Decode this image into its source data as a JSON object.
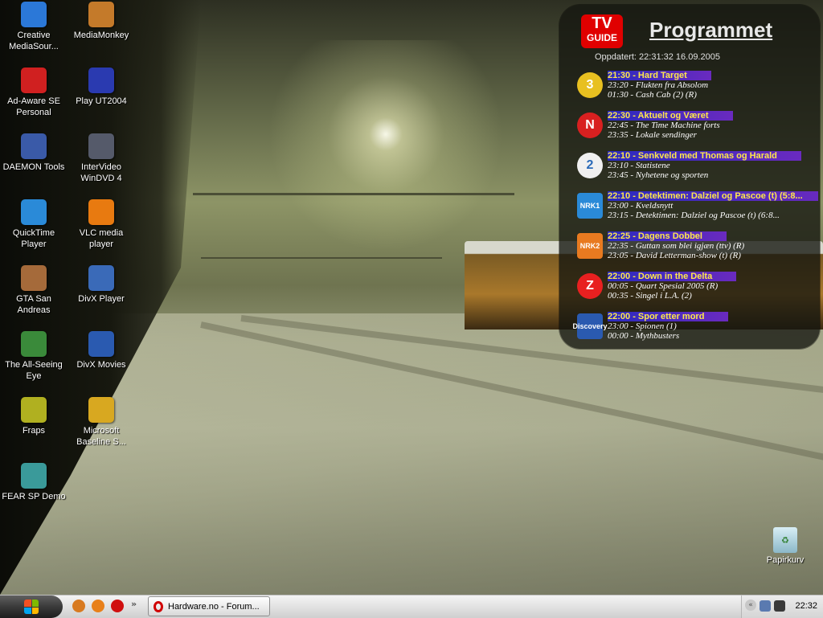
{
  "desktop": {
    "icons": [
      {
        "label": "Creative MediaSour...",
        "icon": "creative-mediasource-icon",
        "color": "#2b78d8"
      },
      {
        "label": "MediaMonkey",
        "icon": "mediamonkey-icon",
        "color": "#c47a2a"
      },
      {
        "label": "Ad-Aware SE Personal",
        "icon": "ad-aware-icon",
        "color": "#d02020"
      },
      {
        "label": "Play UT2004",
        "icon": "ut2004-icon",
        "color": "#2a3ab0"
      },
      {
        "label": "DAEMON Tools",
        "icon": "daemon-tools-icon",
        "color": "#3a5aa8"
      },
      {
        "label": "InterVideo WinDVD 4",
        "icon": "windvd-icon",
        "color": "#555a6a"
      },
      {
        "label": "QuickTime Player",
        "icon": "quicktime-icon",
        "color": "#2a8ad8"
      },
      {
        "label": "VLC media player",
        "icon": "vlc-icon",
        "color": "#e87a10"
      },
      {
        "label": "GTA San Andreas",
        "icon": "gta-san-andreas-icon",
        "color": "#a56a3a"
      },
      {
        "label": "DivX Player",
        "icon": "divx-player-icon",
        "color": "#3a6ab8"
      },
      {
        "label": "The All-Seeing Eye",
        "icon": "all-seeing-eye-icon",
        "color": "#3a8a3a"
      },
      {
        "label": "DivX Movies",
        "icon": "divx-movies-icon",
        "color": "#2a5ab0"
      },
      {
        "label": "Fraps",
        "icon": "fraps-icon",
        "color": "#b0b020"
      },
      {
        "label": "Microsoft Baseline S...",
        "icon": "mbsa-icon",
        "color": "#d8a820"
      },
      {
        "label": "FEAR SP Demo",
        "icon": "fear-icon",
        "color": "#3a9a9a"
      }
    ],
    "recycle_bin": {
      "label": "Papirkurv",
      "icon": "recycle-bin-icon"
    }
  },
  "tvguide": {
    "logo_line1": "TV",
    "logo_line2": "GUIDE",
    "title": "Programmet",
    "updated": "Oppdatert: 22:31:32 16.09.2005",
    "channels": [
      {
        "logo": "3",
        "logo_color": "#e8c020",
        "icon": "tv3-logo-icon",
        "now": "21:30 - Hard Target",
        "next1": "23:20 - Flukten fra Absolom",
        "next2": "01:30 - Cash Cab (2) (R)"
      },
      {
        "logo": "N",
        "logo_color": "#d82020",
        "icon": "tvnorge-logo-icon",
        "now": "22:30 - Aktuelt og Været",
        "next1": "22:45 - The Time Machine forts",
        "next2": "23:35 - Lokale sendinger"
      },
      {
        "logo": "2",
        "logo_color": "#f0f0f0",
        "icon": "tv2-logo-icon",
        "now": "22:10 - Senkveld med Thomas og Harald",
        "next1": "23:10 - Statistene",
        "next2": "23:45 - Nyhetene og sporten"
      },
      {
        "logo": "NRK1",
        "logo_color": "#2a8ad8",
        "icon": "nrk1-logo-icon",
        "now": "22:10 - Detektimen: Dalziel og Pascoe (t) (5:8...",
        "next1": "23:00 - Kveldsnytt",
        "next2": "23:15 - Detektimen: Dalziel og Pascoe (t) (6:8..."
      },
      {
        "logo": "NRK2",
        "logo_color": "#e87a20",
        "icon": "nrk2-logo-icon",
        "now": "22:25 - Dagens Dobbel",
        "next1": "22:35 - Guttan som blei igjæn (ttv) (R)",
        "next2": "23:05 - David Letterman-show (t) (R)"
      },
      {
        "logo": "Z",
        "logo_color": "#e82020",
        "icon": "zebra-logo-icon",
        "now": "22:00 - Down in the Delta",
        "next1": "00:05 - Quart Spesial 2005 (R)",
        "next2": "00:35 - Singel i L.A. (2)"
      },
      {
        "logo": "Discovery",
        "logo_color": "#2a5ab0",
        "icon": "discovery-logo-icon",
        "now": "22:00 - Spor etter mord",
        "next1": "23:00 - Spionen (1)",
        "next2": "00:00 - Mythbusters"
      }
    ]
  },
  "taskbar": {
    "start_icon": "windows-start-icon",
    "quicklaunch": [
      {
        "icon": "gaim-icon",
        "color": "#d87a20"
      },
      {
        "icon": "firefox-icon",
        "color": "#e8801a"
      },
      {
        "icon": "opera-icon",
        "color": "#d01010"
      }
    ],
    "quicklaunch_chevron": "»",
    "task_button": "Hardware.no - Forum...",
    "tray_chevron": "«",
    "tray_icons": [
      {
        "icon": "network-icon",
        "color": "#5a7ab0"
      },
      {
        "icon": "speaker-icon",
        "color": "#3a3a3a"
      }
    ],
    "clock": "22:32"
  }
}
